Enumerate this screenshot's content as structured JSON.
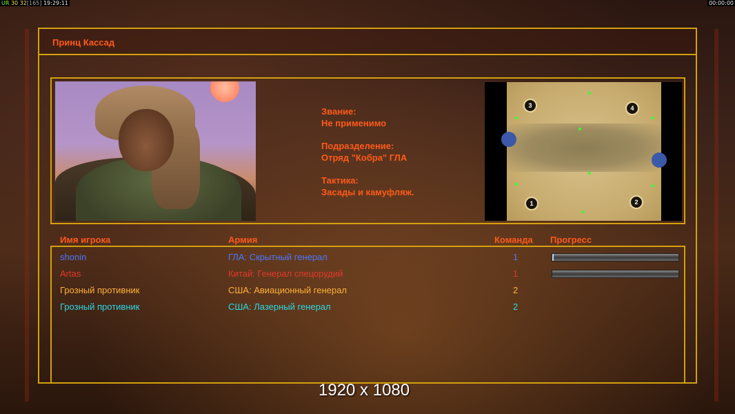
{
  "status_bar": {
    "fps_label": "UR",
    "fps": "30",
    "frame": "32",
    "frame_total": "[165]",
    "clock": "19:29:11",
    "right_timer": "00:00:00"
  },
  "title": "Принц Кассад",
  "general_info": {
    "rank_label": "Звание:",
    "rank_value": "Не применимо",
    "unit_label": "Подразделение:",
    "unit_value": "Отряд \"Кобра\" ГЛА",
    "tactics_label": "Тактика:",
    "tactics_value": "Засады и камуфляж."
  },
  "map": {
    "spawns": [
      "3",
      "4",
      "1",
      "2"
    ]
  },
  "columns": {
    "player": "Имя игрока",
    "army": "Армия",
    "team": "Команда",
    "progress": "Прогресс"
  },
  "players": [
    {
      "name": "shonin",
      "army": "ГЛА: Скрытный генерал",
      "team": "1",
      "color": "#4a78ff",
      "progress": 0.01
    },
    {
      "name": "Artas",
      "army": "Китай: Генерал спецорудий",
      "team": "1",
      "color": "#e23a2a",
      "progress": 0.0
    },
    {
      "name": "Грозный противник",
      "army": "США: Авиационный генерал",
      "team": "2",
      "color": "#ffb23a"
    },
    {
      "name": "Грозный противник",
      "army": "США: Лазерный генерал",
      "team": "2",
      "color": "#2ad7e6"
    }
  ],
  "resolution_overlay": "1920 x 1080",
  "colors": {
    "accent": "#ff5a1a",
    "frame": "#d4a10d"
  }
}
